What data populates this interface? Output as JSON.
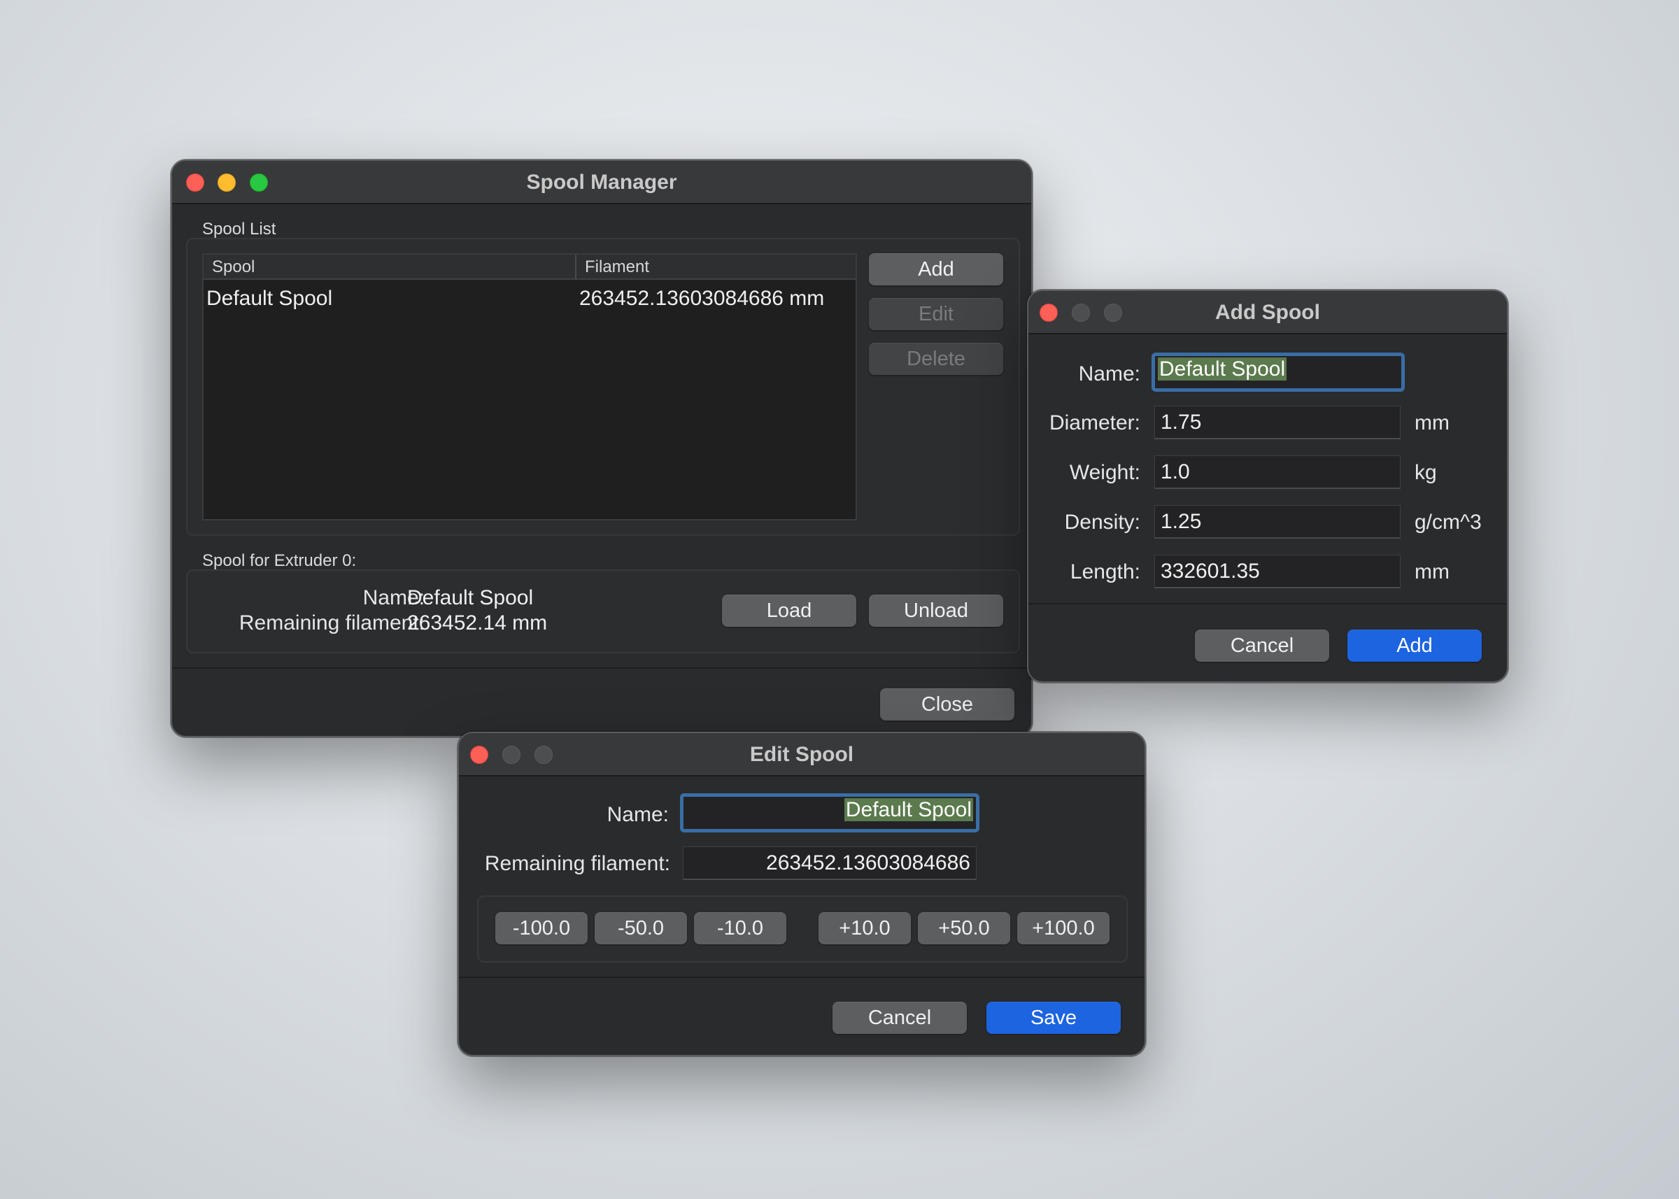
{
  "spool_manager": {
    "title": "Spool Manager",
    "spool_list_label": "Spool List",
    "columns": [
      "Spool",
      "Filament"
    ],
    "rows": [
      {
        "spool": "Default Spool",
        "filament": "263452.13603084686 mm"
      }
    ],
    "add_label": "Add",
    "edit_label": "Edit",
    "delete_label": "Delete",
    "extruder_label": "Spool for Extruder 0:",
    "name_label": "Name:",
    "name_value": "Default Spool",
    "remaining_label": "Remaining filament:",
    "remaining_value": "263452.14 mm",
    "load_label": "Load",
    "unload_label": "Unload",
    "close_label": "Close"
  },
  "add_spool": {
    "title": "Add Spool",
    "name_label": "Name:",
    "name_value": "Default Spool",
    "diameter_label": "Diameter:",
    "diameter_value": "1.75",
    "diameter_unit": "mm",
    "weight_label": "Weight:",
    "weight_value": "1.0",
    "weight_unit": "kg",
    "density_label": "Density:",
    "density_value": "1.25",
    "density_unit": "g/cm^3",
    "length_label": "Length:",
    "length_value": "332601.35",
    "length_unit": "mm",
    "cancel_label": "Cancel",
    "add_label": "Add"
  },
  "edit_spool": {
    "title": "Edit Spool",
    "name_label": "Name:",
    "name_value": "Default Spool",
    "remaining_label": "Remaining filament:",
    "remaining_value": "263452.13603084686",
    "adjust_buttons": [
      "-100.0",
      "-50.0",
      "-10.0",
      "+10.0",
      "+50.0",
      "+100.0"
    ],
    "cancel_label": "Cancel",
    "save_label": "Save"
  },
  "colors": {
    "window_bg": "#2a2b2d",
    "titlebar_bg": "#38393b",
    "accent_blue": "#1c64e0",
    "focus_ring": "#3a6ea5",
    "selection": "#5b7a4d",
    "close_red": "#fe5f57",
    "minimize_yellow": "#febc2e",
    "zoom_green": "#28c840"
  },
  "icons": {
    "window_controls": [
      "close-icon",
      "minimize-icon",
      "zoom-icon"
    ]
  }
}
